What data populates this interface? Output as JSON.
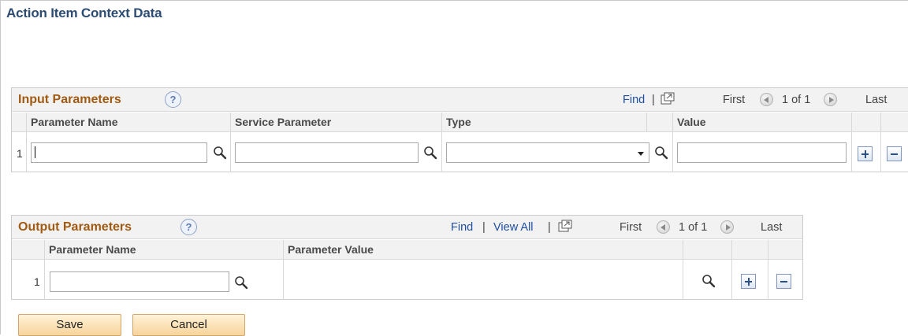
{
  "page": {
    "title": "Action Item Context Data"
  },
  "input_grid": {
    "title": "Input Parameters",
    "help_icon": "?",
    "find": "Find",
    "separator": "|",
    "first": "First",
    "counter": "1 of 1",
    "last": "Last",
    "columns": [
      "Parameter Name",
      "Service Parameter",
      "Type",
      "Value"
    ],
    "rows": [
      {
        "num": "1",
        "parameter_name": "",
        "service_parameter": "",
        "type": "",
        "value": ""
      }
    ]
  },
  "output_grid": {
    "title": "Output Parameters",
    "help_icon": "?",
    "find": "Find",
    "separator": "|",
    "view_all": "View All",
    "first": "First",
    "counter": "1 of 1",
    "last": "Last",
    "columns": [
      "Parameter Name",
      "Parameter Value"
    ],
    "rows": [
      {
        "num": "1",
        "parameter_name": "",
        "parameter_value": ""
      }
    ]
  },
  "buttons": {
    "save": "Save",
    "cancel": "Cancel"
  },
  "icons": {
    "lookup": "magnifier-icon",
    "popout": "new-window-icon",
    "prev": "previous-row-icon",
    "next": "next-row-icon",
    "add_row": "plus-icon",
    "delete_row": "minus-icon"
  },
  "colors": {
    "page_title": "#2c4c74",
    "grid_title": "#a15a12",
    "link": "#1f4ea3",
    "button_fill": "#f7d49a"
  }
}
